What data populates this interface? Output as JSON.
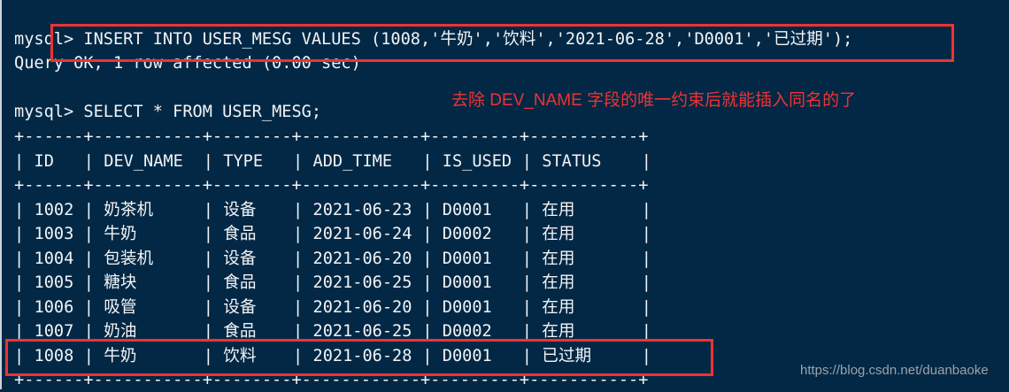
{
  "terminal": {
    "insert_prompt": "mysql> ",
    "insert_command": "INSERT INTO USER_MESG VALUES (1008,'牛奶','饮料','2021-06-28','D0001','已过期');",
    "insert_result": "Query OK, 1 row affected (0.00 sec)",
    "select_prompt": "mysql> ",
    "select_command": "SELECT * FROM USER_MESG;",
    "border": "+------+-----------+--------+------------+---------+-----------+",
    "columns": [
      "ID",
      "DEV_NAME",
      "TYPE",
      "ADD_TIME",
      "IS_USED",
      "STATUS"
    ],
    "rows": [
      [
        "1002",
        "奶茶机",
        "设备",
        "2021-06-23",
        "D0001",
        "在用"
      ],
      [
        "1003",
        "牛奶",
        "食品",
        "2021-06-24",
        "D0002",
        "在用"
      ],
      [
        "1004",
        "包装机",
        "设备",
        "2021-06-20",
        "D0001",
        "在用"
      ],
      [
        "1005",
        "糖块",
        "食品",
        "2021-06-25",
        "D0001",
        "在用"
      ],
      [
        "1006",
        "吸管",
        "设备",
        "2021-06-20",
        "D0001",
        "在用"
      ],
      [
        "1007",
        "奶油",
        "食品",
        "2021-06-25",
        "D0002",
        "在用"
      ],
      [
        "1008",
        "牛奶",
        "饮料",
        "2021-06-28",
        "D0001",
        "已过期"
      ]
    ]
  },
  "annotation": "去除 DEV_NAME 字段的唯一约束后就能插入同名的了",
  "watermark": "https://blog.csdn.net/duanbaoke",
  "colors": {
    "background": "#022845",
    "highlight": "#ee3333"
  }
}
